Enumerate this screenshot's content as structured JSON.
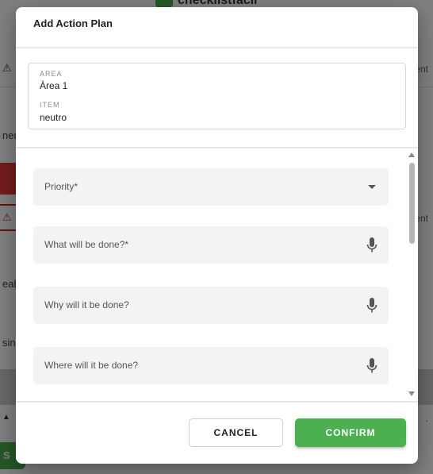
{
  "background": {
    "brand": "checklistfacil",
    "left_texts": [
      "neu",
      "eab",
      "sin"
    ],
    "right_texts": [
      "ent",
      "ent",
      "."
    ],
    "button_label": "S"
  },
  "dialog": {
    "title": "Add Action Plan",
    "area_label": "AREA",
    "area_value": "Àrea 1",
    "item_label": "ITEM",
    "item_value": "neutro",
    "fields": [
      {
        "label": "Priority*",
        "icon": "chevron-down-icon"
      },
      {
        "label": "What will be done?*",
        "icon": "microphone-icon"
      },
      {
        "label": "Why will it be done?",
        "icon": "microphone-icon"
      },
      {
        "label": "Where will it be done?",
        "icon": "microphone-icon"
      }
    ],
    "cancel_label": "CANCEL",
    "confirm_label": "CONFIRM"
  },
  "colors": {
    "accent": "#4caf50",
    "danger": "#e53935"
  }
}
